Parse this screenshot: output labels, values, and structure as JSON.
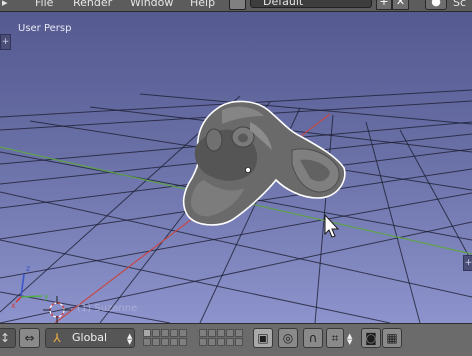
{
  "menus": {
    "file": "File",
    "render": "Render",
    "window": "Window",
    "help": "Help"
  },
  "screen_layout": "Default",
  "viewport": {
    "view_label": "User Persp",
    "object_label": "(1) Suzanne",
    "background_top": "#555a91",
    "background_bottom": "#8d93cc",
    "x_axis_color": "#c44848",
    "y_axis_color": "#5fa24c",
    "object": "monkey-head-mesh",
    "selection_outline_color": "#ffffff"
  },
  "header": {
    "transform_orientation": "Global",
    "icons": [
      "editor-type-icon",
      "manipulator-icon",
      "orientation-icon",
      "layers-icon",
      "render-layer-icon",
      "proportional-edit-icon",
      "snap-magnet-icon",
      "snap-element-icon",
      "opengl-render-icon",
      "opengl-animation-icon"
    ]
  }
}
